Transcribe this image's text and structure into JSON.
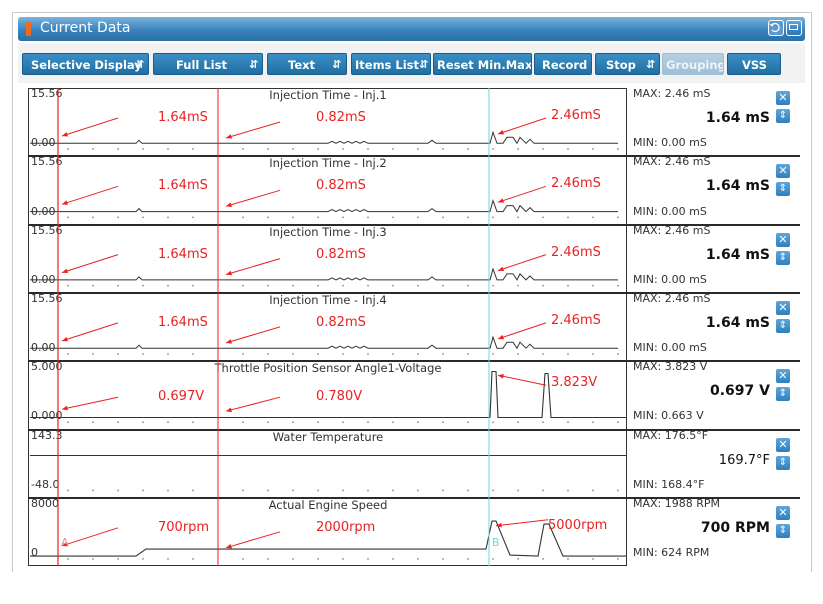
{
  "window": {
    "title": "Current Data",
    "icons": [
      "retry-icon",
      "window-restore-icon"
    ]
  },
  "toolbar": {
    "buttons": [
      {
        "label": "Selective Display",
        "dropdown": true,
        "enabled": true
      },
      {
        "label": "Full List",
        "dropdown": true,
        "enabled": true
      },
      {
        "label": "Text",
        "dropdown": true,
        "enabled": true
      },
      {
        "label": "Items List",
        "dropdown": true,
        "enabled": true
      },
      {
        "label": "Reset Min.Max",
        "dropdown": false,
        "enabled": true
      },
      {
        "label": "Record",
        "dropdown": false,
        "enabled": true
      },
      {
        "label": "Stop",
        "dropdown": true,
        "enabled": true
      },
      {
        "label": "Grouping",
        "dropdown": false,
        "enabled": false
      },
      {
        "label": "VSS",
        "dropdown": false,
        "enabled": true
      }
    ]
  },
  "markers": {
    "a": "A",
    "b": "B"
  },
  "colors": {
    "accent": "#2f7fbd",
    "annotation": "#e82222",
    "marker_b": "#6fd3de"
  },
  "plots": [
    {
      "name": "Injection Time - Inj.1",
      "ymax": "15.56",
      "ymin": "0.00",
      "max": "MAX:  2.46 mS",
      "min": "MIN:  0.00 mS",
      "value": "1.64 mS",
      "annotations": [
        "1.64mS",
        "0.82mS",
        "2.46mS"
      ]
    },
    {
      "name": "Injection Time - Inj.2",
      "ymax": "15.56",
      "ymin": "0.00",
      "max": "MAX:  2.46 mS",
      "min": "MIN:  0.00 mS",
      "value": "1.64 mS",
      "annotations": [
        "1.64mS",
        "0.82mS",
        "2.46mS"
      ]
    },
    {
      "name": "Injection Time - Inj.3",
      "ymax": "15.56",
      "ymin": "0.00",
      "max": "MAX:  2.46 mS",
      "min": "MIN:  0.00 mS",
      "value": "1.64 mS",
      "annotations": [
        "1.64mS",
        "0.82mS",
        "2.46mS"
      ]
    },
    {
      "name": "Injection Time - Inj.4",
      "ymax": "15.56",
      "ymin": "0.00",
      "max": "MAX:  2.46 mS",
      "min": "MIN:  0.00 mS",
      "value": "1.64 mS",
      "annotations": [
        "1.64mS",
        "0.82mS",
        "2.46mS"
      ]
    },
    {
      "name": "Throttle Position Sensor Angle1-Voltage",
      "ymax": "5.000",
      "ymin": "0.000",
      "max": "MAX:  3.823 V",
      "min": "MIN: 0.663 V",
      "value": "0.697 V",
      "annotations": [
        "0.697V",
        "0.780V",
        "3.823V"
      ]
    },
    {
      "name": "Water Temperature",
      "ymax": "143.3",
      "ymin": "-48.0",
      "max": "MAX:  176.5°F",
      "min": "MIN:   168.4°F",
      "value": "169.7°F",
      "annotations": []
    },
    {
      "name": "Actual Engine Speed",
      "ymax": "8000",
      "ymin": "0",
      "max": "MAX:   1988 RPM",
      "min": "MIN:   624 RPM",
      "value": "700 RPM",
      "annotations": [
        "700rpm",
        "2000rpm",
        "5000rpm"
      ]
    }
  ]
}
